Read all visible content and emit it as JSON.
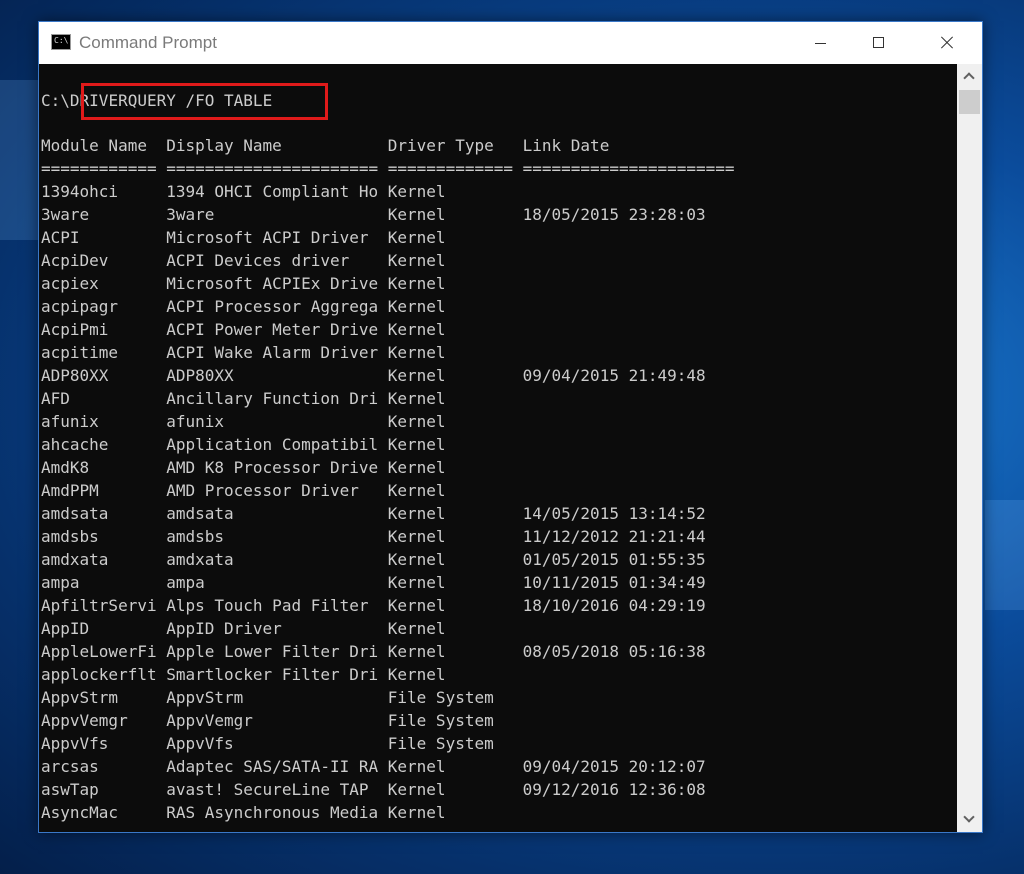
{
  "window": {
    "title": "Command Prompt",
    "icon": "command-prompt-icon",
    "icon_text": "C:\\",
    "controls": [
      "minimize-icon",
      "maximize-icon",
      "close-icon"
    ]
  },
  "console": {
    "prompt": "C:\\",
    "command": "DRIVERQUERY /FO TABLE",
    "headers": [
      "Module Name",
      "Display Name",
      "Driver Type",
      "Link Date"
    ],
    "separators": [
      "============",
      "======================",
      "=============",
      "======================"
    ],
    "rows": [
      [
        "1394ohci",
        "1394 OHCI Compliant Ho",
        "Kernel",
        ""
      ],
      [
        "3ware",
        "3ware",
        "Kernel",
        "18/05/2015 23:28:03"
      ],
      [
        "ACPI",
        "Microsoft ACPI Driver",
        "Kernel",
        ""
      ],
      [
        "AcpiDev",
        "ACPI Devices driver",
        "Kernel",
        ""
      ],
      [
        "acpiex",
        "Microsoft ACPIEx Drive",
        "Kernel",
        ""
      ],
      [
        "acpipagr",
        "ACPI Processor Aggrega",
        "Kernel",
        ""
      ],
      [
        "AcpiPmi",
        "ACPI Power Meter Drive",
        "Kernel",
        ""
      ],
      [
        "acpitime",
        "ACPI Wake Alarm Driver",
        "Kernel",
        ""
      ],
      [
        "ADP80XX",
        "ADP80XX",
        "Kernel",
        "09/04/2015 21:49:48"
      ],
      [
        "AFD",
        "Ancillary Function Dri",
        "Kernel",
        ""
      ],
      [
        "afunix",
        "afunix",
        "Kernel",
        ""
      ],
      [
        "ahcache",
        "Application Compatibil",
        "Kernel",
        ""
      ],
      [
        "AmdK8",
        "AMD K8 Processor Drive",
        "Kernel",
        ""
      ],
      [
        "AmdPPM",
        "AMD Processor Driver",
        "Kernel",
        ""
      ],
      [
        "amdsata",
        "amdsata",
        "Kernel",
        "14/05/2015 13:14:52"
      ],
      [
        "amdsbs",
        "amdsbs",
        "Kernel",
        "11/12/2012 21:21:44"
      ],
      [
        "amdxata",
        "amdxata",
        "Kernel",
        "01/05/2015 01:55:35"
      ],
      [
        "ampa",
        "ampa",
        "Kernel",
        "10/11/2015 01:34:49"
      ],
      [
        "ApfiltrServi",
        "Alps Touch Pad Filter",
        "Kernel",
        "18/10/2016 04:29:19"
      ],
      [
        "AppID",
        "AppID Driver",
        "Kernel",
        ""
      ],
      [
        "AppleLowerFi",
        "Apple Lower Filter Dri",
        "Kernel",
        "08/05/2018 05:16:38"
      ],
      [
        "applockerflt",
        "Smartlocker Filter Dri",
        "Kernel",
        ""
      ],
      [
        "AppvStrm",
        "AppvStrm",
        "File System",
        ""
      ],
      [
        "AppvVemgr",
        "AppvVemgr",
        "File System",
        ""
      ],
      [
        "AppvVfs",
        "AppvVfs",
        "File System",
        ""
      ],
      [
        "arcsas",
        "Adaptec SAS/SATA-II RA",
        "Kernel",
        "09/04/2015 20:12:07"
      ],
      [
        "aswTap",
        "avast! SecureLine TAP",
        "Kernel",
        "09/12/2016 12:36:08"
      ],
      [
        "AsyncMac",
        "RAS Asynchronous Media",
        "Kernel",
        ""
      ]
    ]
  },
  "colors": {
    "console_bg": "#0c0c0c",
    "console_text": "#cccccc",
    "highlight": "#e01a1a",
    "title_text": "#7a7a7a"
  }
}
